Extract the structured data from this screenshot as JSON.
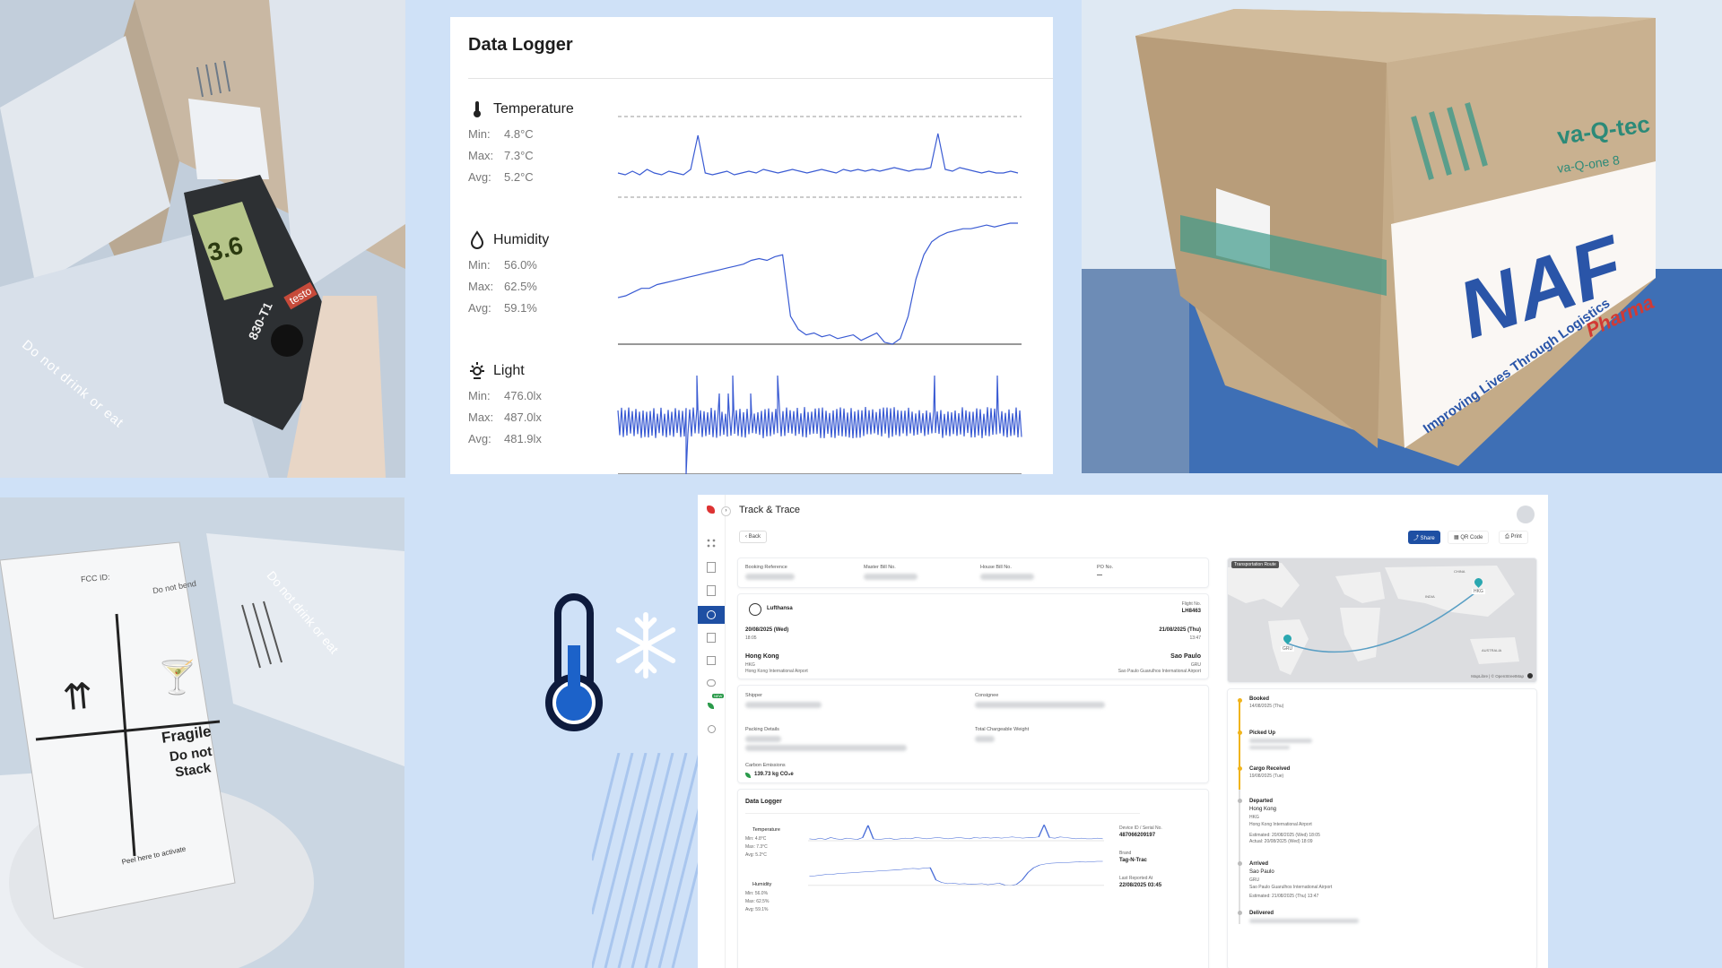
{
  "data_logger": {
    "title": "Data Logger",
    "metrics": [
      {
        "name": "Temperature",
        "min_label": "Min:",
        "min": "4.8°C",
        "max_label": "Max:",
        "max": "7.3°C",
        "avg_label": "Avg:",
        "avg": "5.2°C",
        "icon": "thermometer-icon"
      },
      {
        "name": "Humidity",
        "min_label": "Min:",
        "min": "56.0%",
        "max_label": "Max:",
        "max": "62.5%",
        "avg_label": "Avg:",
        "avg": "59.1%",
        "icon": "droplet-icon"
      },
      {
        "name": "Light",
        "min_label": "Min:",
        "min": "476.0lx",
        "max_label": "Max:",
        "max": "487.0lx",
        "avg_label": "Avg:",
        "avg": "481.9lx",
        "icon": "sun-icon"
      }
    ]
  },
  "chart_data": {
    "type": "line",
    "series": [
      {
        "name": "Temperature",
        "min": 4.8,
        "max": 7.3,
        "avg": 5.2,
        "values": [
          5.1,
          5.0,
          5.2,
          5.0,
          5.3,
          5.1,
          5.0,
          5.2,
          5.1,
          5.0,
          5.3,
          7.2,
          5.1,
          5.0,
          5.1,
          5.2,
          5.0,
          5.1,
          5.2,
          5.1,
          5.3,
          5.2,
          5.1,
          5.2,
          5.3,
          5.2,
          5.1,
          5.2,
          5.3,
          5.2,
          5.1,
          5.3,
          5.2,
          5.3,
          5.2,
          5.3,
          5.2,
          5.3,
          5.4,
          5.3,
          5.2,
          5.3,
          5.3,
          5.4,
          7.3,
          5.3,
          5.2,
          5.4,
          5.3,
          5.2,
          5.1,
          5.2,
          5.1,
          5.1,
          5.2,
          5.1
        ]
      },
      {
        "name": "Humidity",
        "min": 56.0,
        "max": 62.5,
        "avg": 59.1,
        "values": [
          58.5,
          58.6,
          58.8,
          59.0,
          59.0,
          59.2,
          59.3,
          59.4,
          59.5,
          59.6,
          59.7,
          59.8,
          59.9,
          60.0,
          60.1,
          60.2,
          60.3,
          60.5,
          60.6,
          60.5,
          60.7,
          60.8,
          57.5,
          56.8,
          56.5,
          56.6,
          56.4,
          56.5,
          56.3,
          56.4,
          56.5,
          56.2,
          56.4,
          56.6,
          56.1,
          56.0,
          56.3,
          57.5,
          59.5,
          60.8,
          61.5,
          61.8,
          62.0,
          62.1,
          62.2,
          62.2,
          62.3,
          62.4,
          62.3,
          62.4,
          62.5,
          62.5
        ]
      },
      {
        "name": "Light",
        "min": 476.0,
        "max": 487.0,
        "avg": 481.9
      }
    ]
  },
  "track_trace": {
    "title": "Track & Trace",
    "back": "Back",
    "share": "Share",
    "qr_code": "QR Code",
    "print": "Print",
    "new_badge": "NEW",
    "refs": {
      "booking_reference": "Booking Reference",
      "master_bill": "Master Bill No.",
      "house_bill": "House Bill No.",
      "po_no": "PO No.",
      "po_value": "—"
    },
    "flight": {
      "airline": "Lufthansa",
      "flight_no_label": "Flight No.",
      "flight_no": "LH8463",
      "dep_date": "20/08/2025 (Wed)",
      "dep_time": "18:05",
      "arr_date": "21/08/2025 (Thu)",
      "arr_time": "13:47",
      "origin_city": "Hong Kong",
      "origin_code": "HKG",
      "origin_airport": "Hong Kong International Airport",
      "dest_city": "Sao Paulo",
      "dest_code": "GRU",
      "dest_airport": "Sao Paulo Guarulhos International Airport"
    },
    "parties": {
      "shipper": "Shipper",
      "consignee": "Consignee",
      "packing": "Packing Details",
      "weight": "Total Chargeable Weight",
      "carbon": "Carbon Emissions",
      "carbon_value": "139.73 kg CO₂e"
    },
    "logger": {
      "title": "Data Logger",
      "temperature": "Temperature",
      "t_min": "Min: 4.8°C",
      "t_max": "Max: 7.3°C",
      "t_avg": "Avg: 5.2°C",
      "humidity": "Humidity",
      "h_min": "Min: 56.0%",
      "h_max": "Max: 62.5%",
      "h_avg": "Avg: 59.1%",
      "device_label": "Device ID / Serial No.",
      "device_value": "487066209197",
      "brand_label": "Brand",
      "brand_value": "Tag-N-Trac",
      "last_label": "Last Reported At",
      "last_value": "22/08/2025 03:45"
    },
    "map": {
      "label": "Transportation Route",
      "attribution": "MapLibre | © OpenStreetMap",
      "pin_origin": "HKG",
      "pin_dest": "GRU",
      "china": "CHINA",
      "australia": "AUSTRALIA",
      "india": "INDIA"
    },
    "timeline": [
      {
        "status": "Booked",
        "detail": "14/08/2025 (Thu)"
      },
      {
        "status": "Picked Up",
        "detail": ""
      },
      {
        "status": "Cargo Received",
        "detail": "19/08/2025 (Tue)"
      },
      {
        "status": "Departed",
        "detail": "Hong Kong",
        "code": "HKG",
        "airport": "Hong Kong International Airport",
        "est": "Estimated: 20/08/2025 (Wed) 18:05",
        "act": "Actual: 20/08/2025 (Wed) 18:09"
      },
      {
        "status": "Arrived",
        "detail": "Sao Paulo",
        "code": "GRU",
        "airport": "Sao Paulo Guarulhos International Airport",
        "est": "Estimated: 21/08/2025 (Thu) 13:47"
      },
      {
        "status": "Delivered",
        "detail": ""
      }
    ]
  },
  "photos": {
    "box_brand": "va-Q-tec",
    "box_model": "va-Q-one 8",
    "naf": "NAF",
    "naf_sub": "Pharma",
    "naf_tagline": "Improving Lives Through Logistics",
    "meter_model": "830-T1",
    "meter_brand": "testo",
    "meter_reading": "3.6",
    "box_side_text": "Do not drink or eat",
    "label_fcc": "FCC ID:",
    "label_fragile": "Fragile",
    "label_do_not_stack": "Do not Stack",
    "label_do_not_bend": "Do not bend",
    "label_peel": "Peel here to activate"
  },
  "colors": {
    "accent": "#1e4fa3",
    "line": "#3a5bd3",
    "background": "#cfe1f7"
  }
}
